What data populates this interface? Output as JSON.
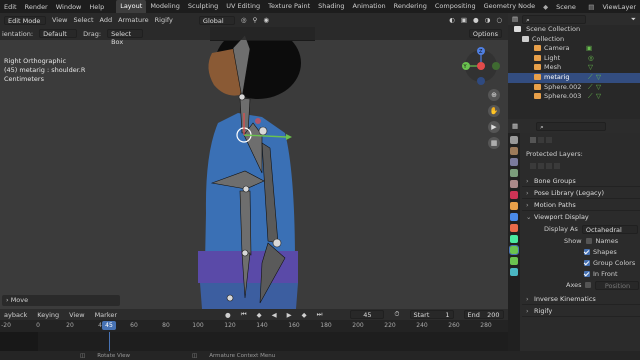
{
  "menubar": {
    "menus": [
      "Edit",
      "Render",
      "Window",
      "Help"
    ],
    "workspaces": [
      "Layout",
      "Modeling",
      "Sculpting",
      "UV Editing",
      "Texture Paint",
      "Shading",
      "Animation",
      "Rendering",
      "Compositing",
      "Geometry Node"
    ],
    "active_workspace": "Layout",
    "scene": "Scene",
    "view_layer": "ViewLayer"
  },
  "viewport": {
    "header": {
      "mode": "Edit Mode",
      "menus": [
        "View",
        "Select",
        "Add",
        "Armature",
        "Rigify"
      ],
      "orientation": "Global"
    },
    "header2": {
      "orientation_label": "ientation:",
      "orientation_value": "Default",
      "drag_label": "Drag:",
      "drag_value": "Select Box",
      "options": "Options"
    },
    "info": [
      "Right Orthographic",
      "(45) metarig : shoulder.R",
      "Centimeters"
    ],
    "last_op": "Move",
    "gizmo_labels": {
      "y": "Y",
      "z": "Z"
    }
  },
  "timeline": {
    "menus": [
      "ayback",
      "Keying",
      "View",
      "Marker"
    ],
    "current_frame": "45",
    "start_label": "Start",
    "start": "1",
    "end_label": "End",
    "end": "200",
    "ticks": [
      "-20",
      "0",
      "20",
      "40",
      "60",
      "80",
      "100",
      "120",
      "140",
      "160",
      "180",
      "200",
      "220",
      "240",
      "260",
      "280"
    ]
  },
  "statusbar": {
    "items": [
      "Rotate View",
      "Armature Context Menu"
    ]
  },
  "outliner": {
    "title": "Scene Collection",
    "items": [
      {
        "label": "Collection",
        "color": "#e8e8e8",
        "icon": "#cfcfcf"
      },
      {
        "label": "Camera",
        "color": "#e8e8e8",
        "icon": "#e8a04a"
      },
      {
        "label": "Light",
        "color": "#e8e8e8",
        "icon": "#e8a04a"
      },
      {
        "label": "Mesh",
        "color": "#e8e8e8",
        "icon": "#e8a04a"
      },
      {
        "label": "metarig",
        "color": "#ffffff",
        "icon": "#e8a04a"
      },
      {
        "label": "Sphere.002",
        "color": "#e8e8e8",
        "icon": "#e8a04a"
      },
      {
        "label": "Sphere.003",
        "color": "#e8e8e8",
        "icon": "#e8a04a"
      }
    ]
  },
  "properties": {
    "protected_layers": "Protected Layers:",
    "panels_collapsed": [
      "Bone Groups",
      "Pose Library (Legacy)",
      "Motion Paths"
    ],
    "viewport_display": {
      "title": "Viewport Display",
      "display_as_label": "Display As",
      "display_as_value": "Octahedral",
      "show_label": "Show",
      "checks": [
        {
          "label": "Names",
          "checked": false
        },
        {
          "label": "Shapes",
          "checked": true
        },
        {
          "label": "Group Colors",
          "checked": true
        },
        {
          "label": "In Front",
          "checked": true
        }
      ],
      "axes_label": "Axes",
      "axes_position": "Position"
    },
    "panels_after": [
      "Inverse Kinematics",
      "Rigify"
    ]
  },
  "colors": {
    "accent": "#4772b3",
    "selected": "#334d80",
    "bone_gray": "#6e6e6e",
    "shirt_blue": "#3a70b5"
  }
}
